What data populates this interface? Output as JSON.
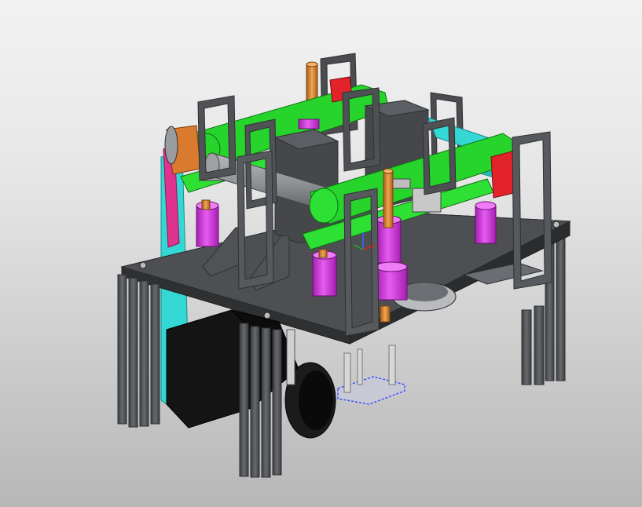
{
  "viewport": {
    "background_top": "#f2f2f2",
    "background_bottom": "#b7b7b7"
  },
  "model": {
    "colors": {
      "plate": "#4d4f53",
      "plate_side": "#37393c",
      "frame": "#56595d",
      "frame_edge": "#2f3133",
      "belt": "#27d42c",
      "belt_dark": "#189b1c",
      "roller": "#8f9396",
      "spacer": "#d42fe0",
      "shaft": "#e08a2a",
      "bracket_cyan": "#33d7d3",
      "bracket_pink": "#e0328f",
      "bracket_red": "#e2232a",
      "bracket_orange": "#d97a2e",
      "motor": "#101010",
      "selection": "#3b55ff"
    },
    "icons": [
      "coordinate-triad-icon"
    ]
  }
}
